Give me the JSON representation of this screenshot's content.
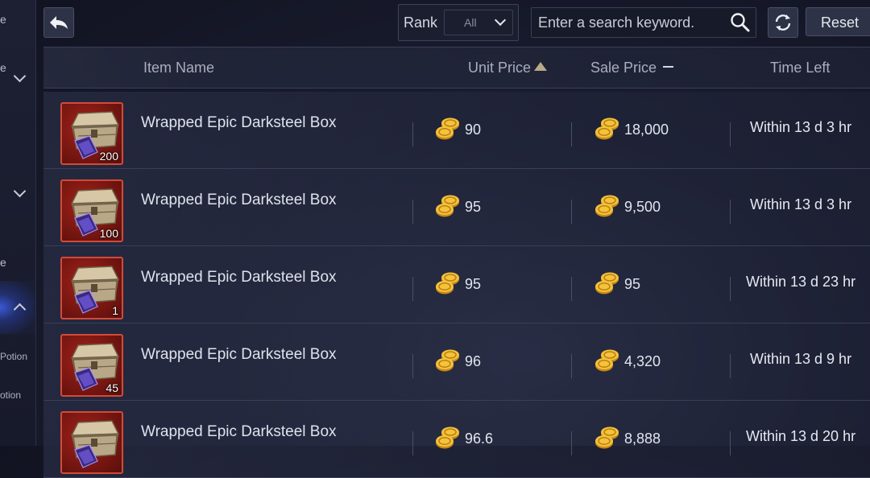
{
  "sidebar": {
    "items": [
      {
        "label": "e"
      },
      {
        "label": "e"
      },
      {
        "label": "e"
      },
      {
        "label": "Potion"
      },
      {
        "label": "otion"
      }
    ]
  },
  "filter": {
    "rank_label": "Rank",
    "rank_value": "All"
  },
  "search": {
    "placeholder": "Enter a search keyword."
  },
  "toolbar": {
    "reset_label": "Reset"
  },
  "table": {
    "columns": {
      "item_name": "Item Name",
      "unit_price": "Unit Price",
      "sale_price": "Sale Price",
      "time_left": "Time Left"
    },
    "rows": [
      {
        "name": "Wrapped Epic Darksteel Box",
        "qty": "200",
        "unit_price": "90",
        "sale_price": "18,000",
        "time_left": "Within 13 d 3 hr"
      },
      {
        "name": "Wrapped Epic Darksteel Box",
        "qty": "100",
        "unit_price": "95",
        "sale_price": "9,500",
        "time_left": "Within 13 d 3 hr"
      },
      {
        "name": "Wrapped Epic Darksteel Box",
        "qty": "1",
        "unit_price": "95",
        "sale_price": "95",
        "time_left": "Within 13 d 23 hr"
      },
      {
        "name": "Wrapped Epic Darksteel Box",
        "qty": "45",
        "unit_price": "96",
        "sale_price": "4,320",
        "time_left": "Within 13 d 9 hr"
      },
      {
        "name": "Wrapped Epic Darksteel Box",
        "qty": "",
        "unit_price": "96.6",
        "sale_price": "8,888",
        "time_left": "Within 13 d 20 hr"
      }
    ]
  },
  "colors": {
    "background": "#1a1d30",
    "item_frame": "#d24a3a",
    "coin_gold": "#f2b632",
    "sort_arrow": "#b8ab88"
  },
  "icons": {
    "back": "back-arrow-icon",
    "search": "search-icon",
    "refresh": "refresh-icon",
    "coin": "gold-coin-icon",
    "item": "darksteel-box-icon"
  }
}
